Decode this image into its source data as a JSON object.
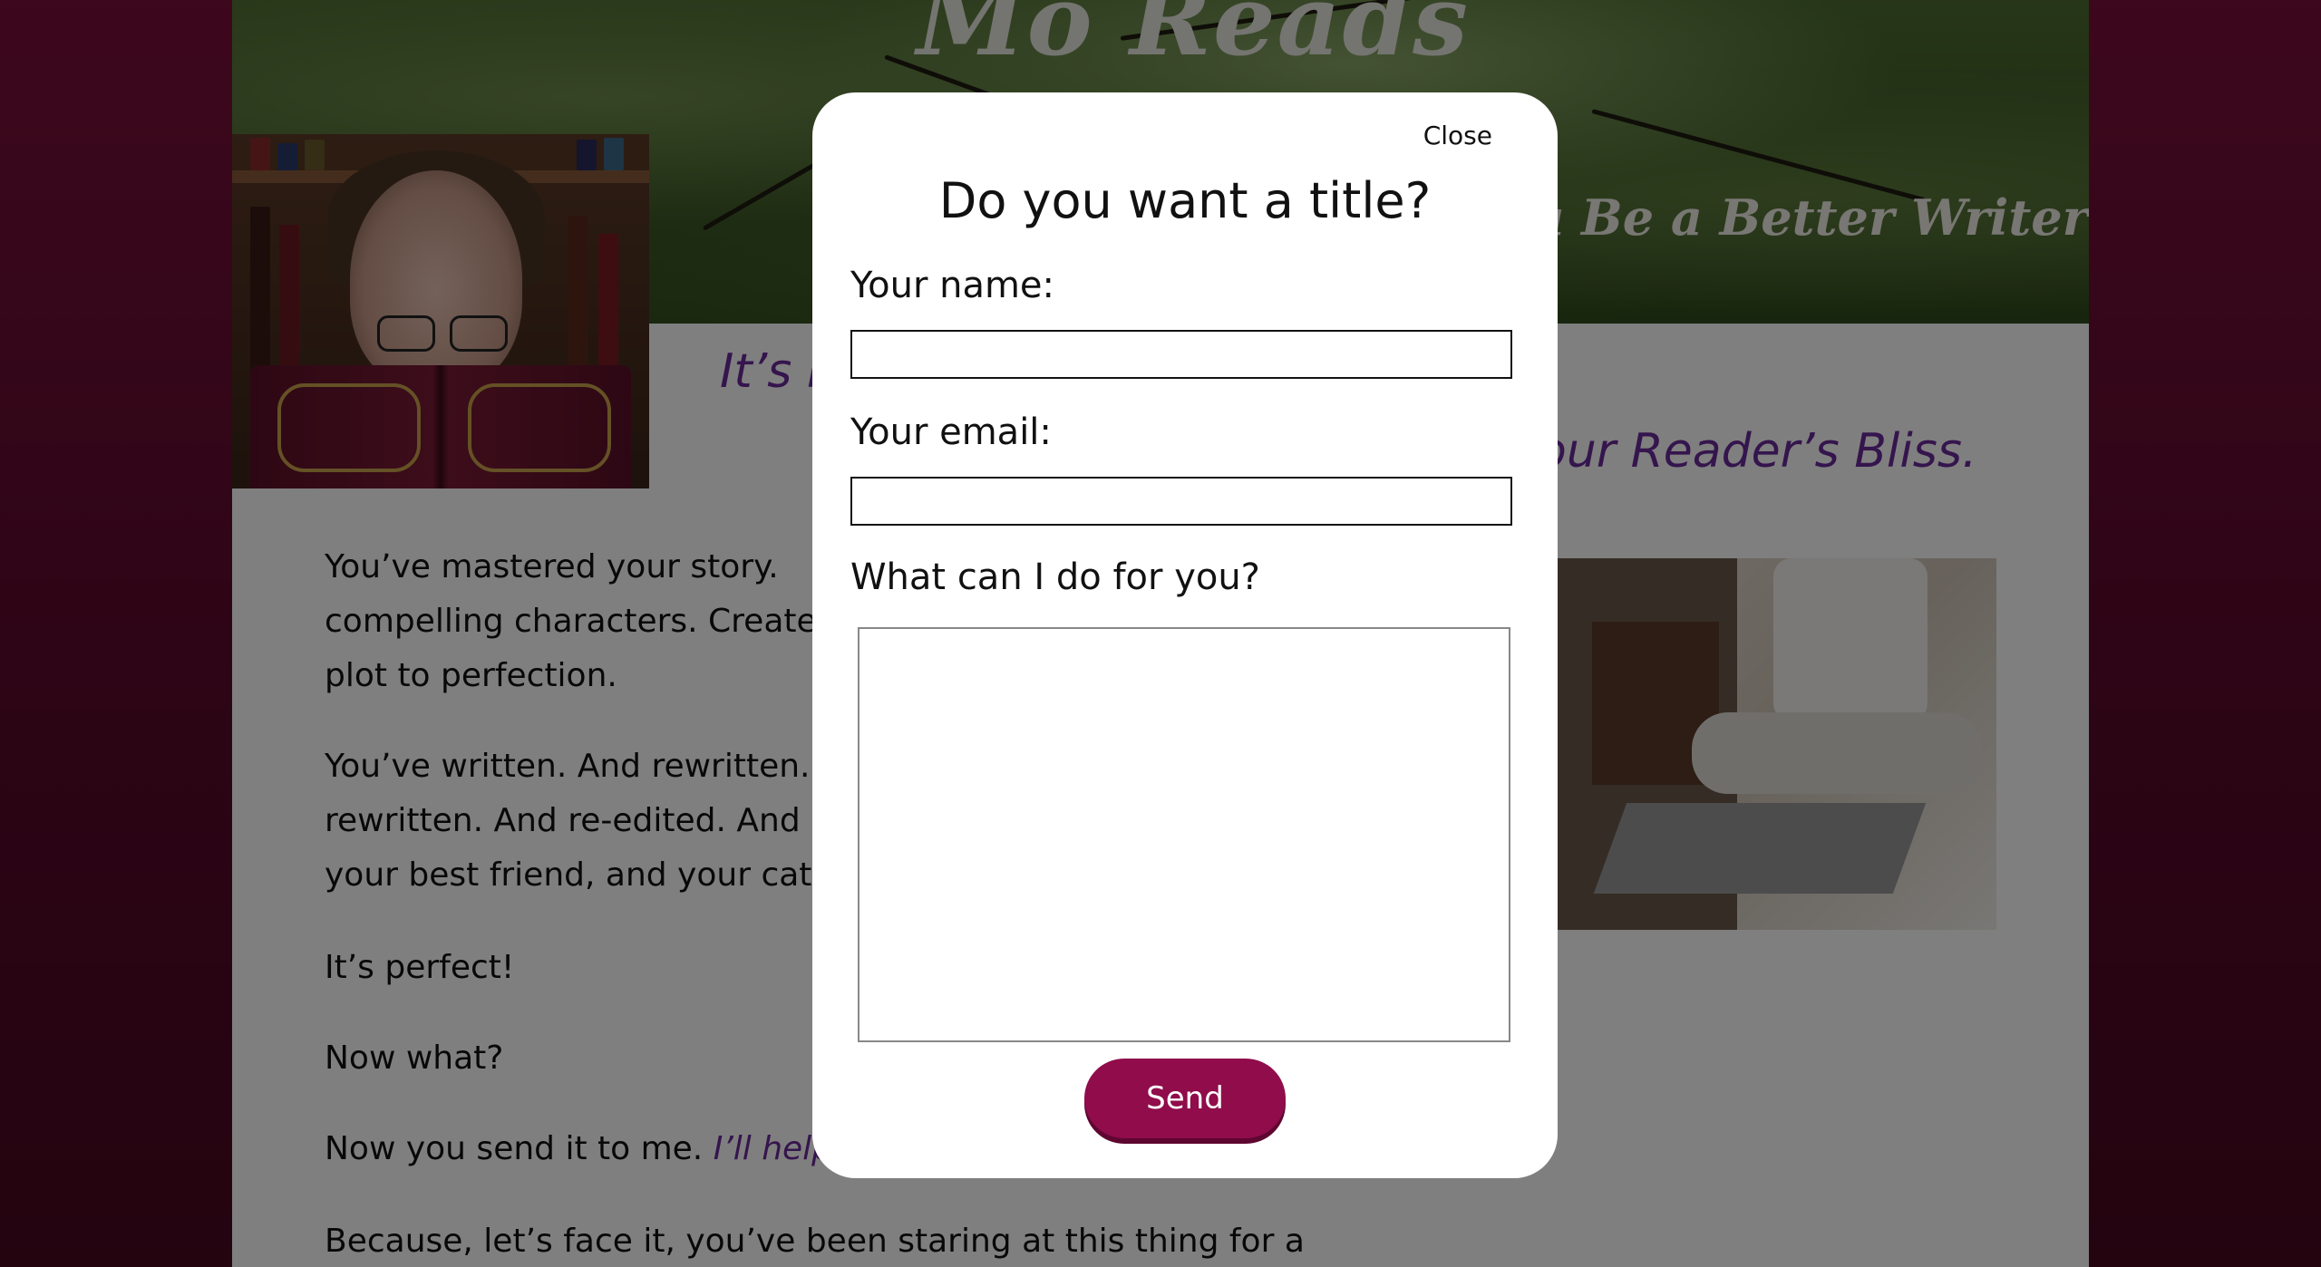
{
  "site": {
    "title": "Mo Reads You",
    "tagline": "u Be a Better Writer"
  },
  "headings": {
    "left_fragment": "It’s r",
    "right_fragment": "our Reader’s Bliss."
  },
  "content": {
    "p1_l1": "You’ve mastered your story.",
    "p1_l2": "compelling characters. Created",
    "p1_l3": "plot to perfection.",
    "p2_l1": "You’ve written. And rewritten.",
    "p2_l2": "rewritten. And re-edited. And r",
    "p2_l3": "your best friend, and your cat r",
    "p3": "It’s perfect!",
    "p4": "Now what?",
    "p5_plain": "Now you send it to me. ",
    "p5_italic": "I’ll help",
    "p6_l1": "Because, let’s face it, you’ve been staring at this thing for a"
  },
  "modal": {
    "close_label": "Close",
    "title": "Do you want a title?",
    "name_label": "Your name:",
    "name_value": "",
    "email_label": "Your email:",
    "email_value": "",
    "message_label": "What can I do for you?",
    "message_value": "",
    "send_label": "Send"
  },
  "colors": {
    "accent": "#900c4a",
    "heading_purple": "#6a2a9a",
    "outer_background": "#5a0a2b"
  }
}
